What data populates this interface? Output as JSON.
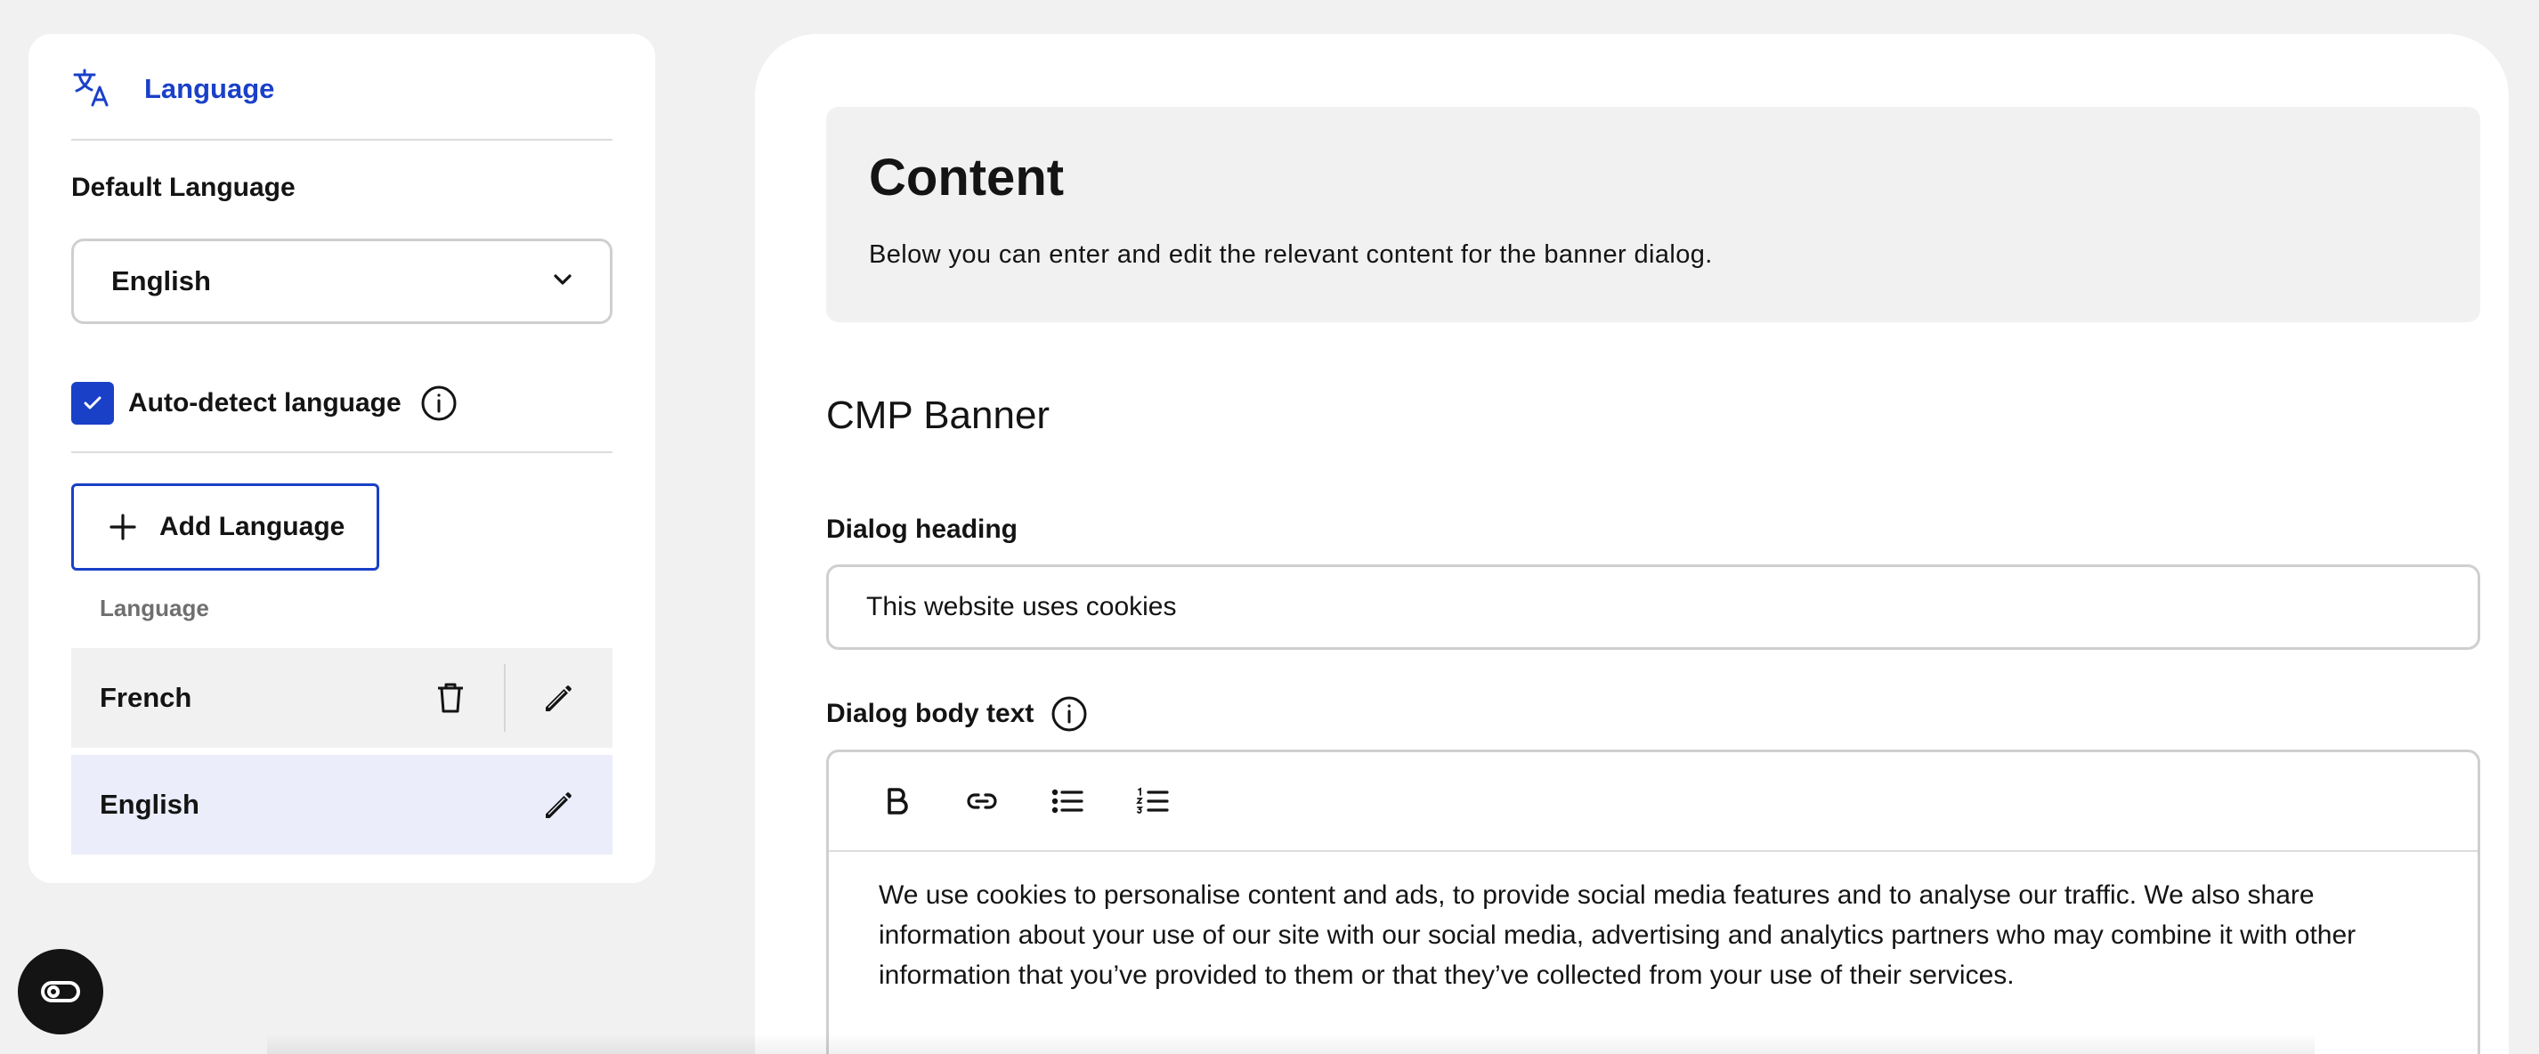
{
  "colors": {
    "accent": "#1a40c8",
    "selected_row": "#ebedfa",
    "panel_bg": "#f1f1f1"
  },
  "sidebar": {
    "header": {
      "icon": "translate-icon",
      "title": "Language"
    },
    "default_language_label": "Default Language",
    "default_language_value": "English",
    "auto_detect": {
      "label": "Auto-detect language",
      "checked": true
    },
    "add_language_label": "Add Language",
    "list_header": "Language",
    "languages": [
      {
        "name": "French",
        "deletable": true
      },
      {
        "name": "English",
        "deletable": false,
        "selected": true
      }
    ]
  },
  "main": {
    "content_card": {
      "title": "Content",
      "subtitle": "Below you can enter and edit the relevant content for the banner dialog."
    },
    "section_title": "CMP Banner",
    "dialog_heading": {
      "label": "Dialog heading",
      "value": "This website uses cookies"
    },
    "dialog_body": {
      "label": "Dialog body text",
      "toolbar": [
        "bold-icon",
        "link-icon",
        "bullet-list-icon",
        "numbered-list-icon"
      ],
      "text": "We use cookies to personalise content and ads, to provide social media features and to analyse our traffic. We also share information about your use of our site with our social media, advertising and analytics partners who may combine it with other information that you’ve provided to them or that they’ve collected from your use of their services."
    }
  }
}
